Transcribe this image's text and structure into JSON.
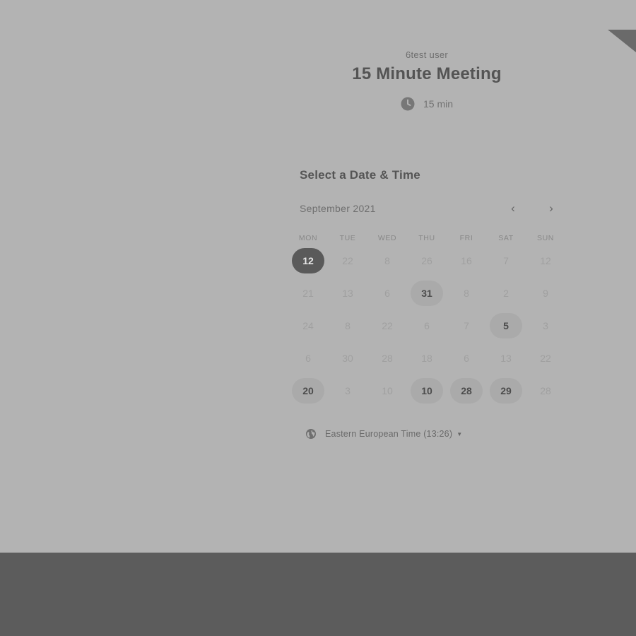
{
  "event": {
    "organizer": "6test user",
    "title": "15 Minute Meeting",
    "duration": "15 min"
  },
  "picker": {
    "heading": "Select a Date & Time",
    "month_label": "September 2021",
    "prev_label": "‹",
    "next_label": "›",
    "weekdays": [
      "MON",
      "TUE",
      "WED",
      "THU",
      "FRI",
      "SAT",
      "SUN"
    ],
    "weeks": [
      [
        {
          "n": "12",
          "s": "selected"
        },
        {
          "n": "22",
          "s": "off"
        },
        {
          "n": "8",
          "s": "off"
        },
        {
          "n": "26",
          "s": "off"
        },
        {
          "n": "16",
          "s": "off"
        },
        {
          "n": "7",
          "s": "off"
        },
        {
          "n": "12",
          "s": "off"
        }
      ],
      [
        {
          "n": "21",
          "s": "off"
        },
        {
          "n": "13",
          "s": "off"
        },
        {
          "n": "6",
          "s": "off"
        },
        {
          "n": "31",
          "s": "available"
        },
        {
          "n": "8",
          "s": "off"
        },
        {
          "n": "2",
          "s": "off"
        },
        {
          "n": "9",
          "s": "off"
        }
      ],
      [
        {
          "n": "24",
          "s": "off"
        },
        {
          "n": "8",
          "s": "off"
        },
        {
          "n": "22",
          "s": "off"
        },
        {
          "n": "6",
          "s": "off"
        },
        {
          "n": "7",
          "s": "off"
        },
        {
          "n": "5",
          "s": "available"
        },
        {
          "n": "3",
          "s": "off"
        }
      ],
      [
        {
          "n": "6",
          "s": "off"
        },
        {
          "n": "30",
          "s": "off"
        },
        {
          "n": "28",
          "s": "off"
        },
        {
          "n": "18",
          "s": "off"
        },
        {
          "n": "6",
          "s": "off"
        },
        {
          "n": "13",
          "s": "off"
        },
        {
          "n": "22",
          "s": "off"
        }
      ],
      [
        {
          "n": "20",
          "s": "available"
        },
        {
          "n": "3",
          "s": "off"
        },
        {
          "n": "10",
          "s": "off"
        },
        {
          "n": "10",
          "s": "available"
        },
        {
          "n": "28",
          "s": "available"
        },
        {
          "n": "29",
          "s": "available"
        },
        {
          "n": "28",
          "s": "off"
        }
      ]
    ]
  },
  "timezone": {
    "label": "Eastern European Time (13:26)"
  },
  "colors": {
    "page_bg": "#b3b3b3",
    "footer_bg": "#5c5c5c",
    "selected": "#5a5a5a",
    "available": "#aaaaaa"
  },
  "icons": {
    "duration": "clock-icon",
    "timezone": "globe-icon",
    "timezone_dropdown": "caret-down-icon"
  }
}
